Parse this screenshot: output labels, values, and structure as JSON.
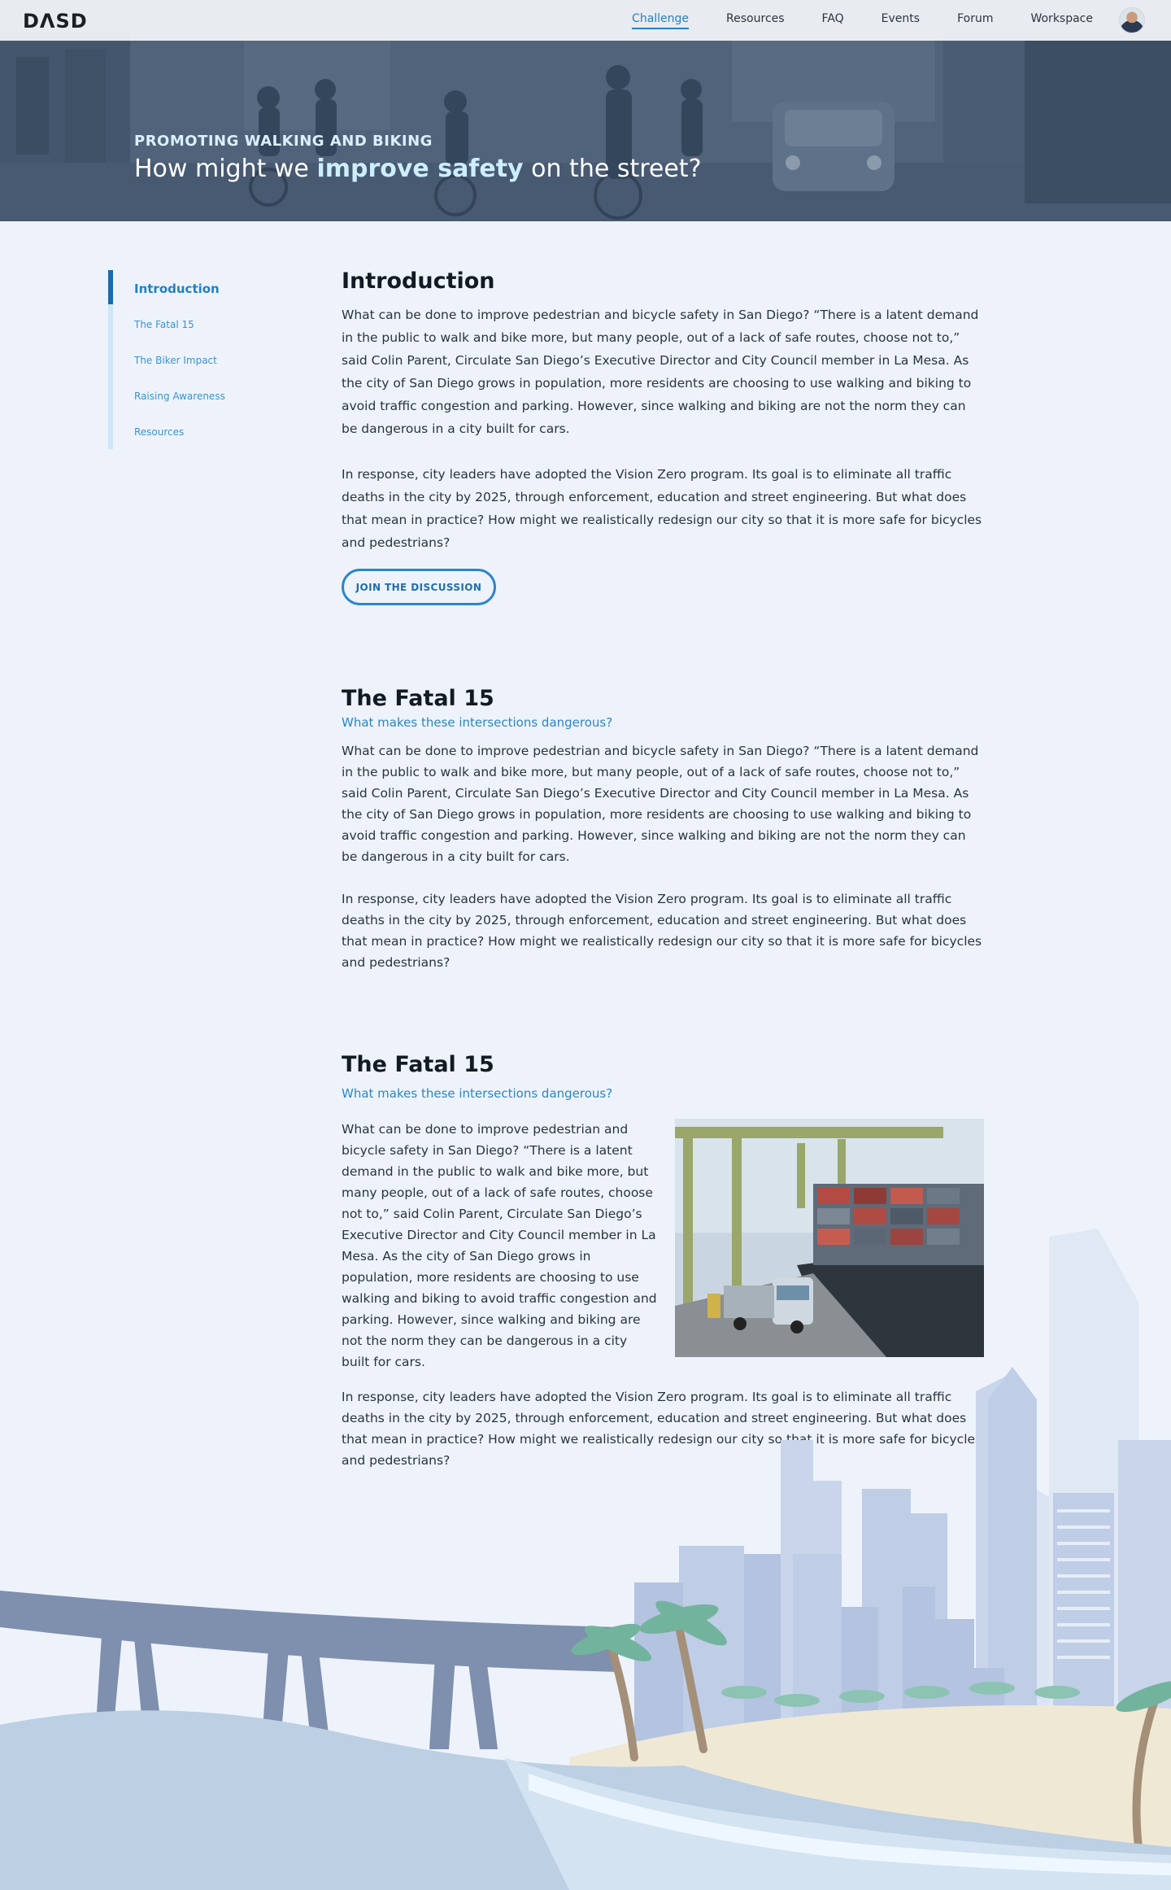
{
  "nav": {
    "logo": "DΛSD",
    "links": [
      "Challenge",
      "Resources",
      "FAQ",
      "Events",
      "Forum",
      "Workspace"
    ],
    "active": "Challenge"
  },
  "hero": {
    "eyebrow": "PROMOTING WALKING AND BIKING",
    "title_before": "How might we ",
    "title_highlight": "improve safety",
    "title_after": " on the street?"
  },
  "sidebar": {
    "items": [
      "Introduction",
      "The Fatal 15",
      "The Biker Impact",
      "Raising Awareness",
      "Resources"
    ]
  },
  "intro": {
    "heading": "Introduction",
    "p1": "What can be done to improve pedestrian and bicycle safety in San Diego? “There is a latent demand in the public to walk and bike more, but many people, out of a lack of safe routes, choose not to,” said Colin Parent, Circulate San Diego’s Executive Director and City Council member in La Mesa. As the city of San Diego grows in population, more residents are choosing to use walking and biking to avoid traffic congestion and parking. However, since walking and biking are not the norm they can be dangerous in a city built for cars.",
    "p2": "In response, city leaders have adopted the Vision Zero program. Its goal is to eliminate all traffic deaths in the city by 2025, through enforcement, education and street engineering. But what does that mean in practice? How might we realistically redesign our city so that it is more safe for bicycles and pedestrians?",
    "button": "JOIN THE DISCUSSION"
  },
  "fatal1": {
    "heading": "The Fatal 15",
    "sub": "What makes these intersections dangerous?",
    "p1": "What can be done to improve pedestrian and bicycle safety in San Diego? “There is a latent demand in the public to walk and bike more, but many people, out of a lack of safe routes, choose not to,” said Colin Parent, Circulate San Diego’s Executive Director and City Council member in La Mesa. As the city of San Diego grows in population, more residents are choosing to use walking and biking to avoid traffic congestion and parking. However, since walking and biking are not the norm they can be dangerous in a city built for cars.",
    "p2": "In response, city leaders have adopted the Vision Zero program. Its goal is to eliminate all traffic deaths in the city by 2025, through enforcement, education and street engineering. But what does that mean in practice? How might we realistically redesign our city so that it is more safe for bicycles and pedestrians?"
  },
  "fatal2": {
    "heading": "The Fatal 15",
    "sub": "What makes these intersections dangerous?",
    "p1": "What can be done to improve pedestrian and bicycle safety in San Diego? “There is a latent demand in the public to walk and bike more, but many people, out of a lack of safe routes, choose not to,” said Colin Parent, Circulate San Diego’s Executive Director and City Council member in La Mesa. As the city of San Diego grows in population, more residents are choosing to use walking and biking to avoid traffic congestion and parking. However, since walking and biking are not the norm they can be dangerous in a city built for cars.",
    "p2": "In response, city leaders have adopted the Vision Zero program. Its goal is to eliminate all traffic deaths in the city by 2025, through enforcement, education and street engineering. But what does that mean in practice? How might we realistically redesign our city so that it is more safe for bicycles and pedestrians?"
  },
  "colors": {
    "accent": "#2b86c8",
    "sidebar_active": "#1c6aae",
    "page_bg": "#eef3fb"
  }
}
